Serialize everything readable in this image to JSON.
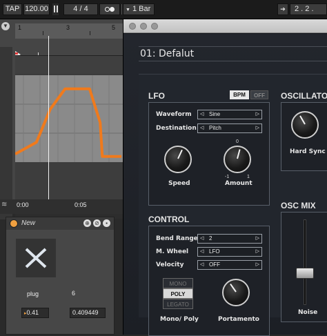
{
  "transport": {
    "tap_label": "TAP",
    "tempo": "120.00",
    "time_sig_num": "4",
    "time_sig_sep": "/",
    "time_sig_den": "4",
    "quantize": "1 Bar",
    "position": "2 .   2 ."
  },
  "clip": {
    "ruler_marks": [
      "1",
      "3",
      "5"
    ],
    "time_labels": [
      "0:00",
      "0:05"
    ],
    "envelope_points": [
      [
        0,
        0.05
      ],
      [
        0.2,
        0.2
      ],
      [
        0.33,
        0.62
      ],
      [
        0.47,
        0.88
      ],
      [
        0.7,
        0.88
      ],
      [
        0.8,
        0.45
      ],
      [
        0.82,
        0.02
      ],
      [
        1.0,
        0.02
      ]
    ]
  },
  "device": {
    "title": "New",
    "plug_label": "plug",
    "value_6": "6",
    "value_a": "0.41",
    "value_b": "0.409449"
  },
  "plugin": {
    "preset": "01: Defalut",
    "lfo": {
      "title": "LFO",
      "bpm_label": "BPM",
      "off_label": "OFF",
      "waveform_label": "Waveform",
      "waveform_value": "Sine",
      "destination_label": "Destination",
      "destination_value": "Pitch",
      "speed_label": "Speed",
      "amount_label": "Amount",
      "amount_zero": "0",
      "amount_min": "-1",
      "amount_max": "1"
    },
    "control": {
      "title": "CONTROL",
      "bend_label": "Bend Range",
      "bend_value": "2",
      "wheel_label": "M. Wheel",
      "wheel_value": "LFO",
      "velocity_label": "Velocity",
      "velocity_value": "OFF",
      "mono_label": "MONO",
      "poly_label": "POLY",
      "legato_label": "LEGATO",
      "monopoly_label": "Mono/ Poly",
      "portamento_label": "Portamento"
    },
    "oscillator": {
      "title": "OSCILLATO",
      "hardsync_label": "Hard Sync"
    },
    "oscmix": {
      "title": "OSC MIX",
      "noise_label": "Noise",
      "noise_level": 0.35
    }
  }
}
